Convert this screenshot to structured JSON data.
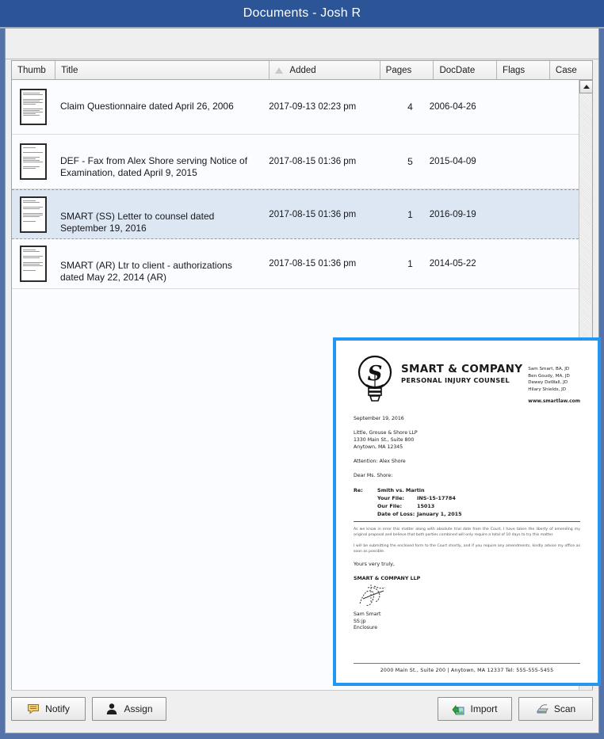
{
  "window": {
    "title": "Documents - Josh R"
  },
  "grid": {
    "columns": [
      {
        "key": "thumb",
        "label": "Thumb",
        "sorted": false
      },
      {
        "key": "title",
        "label": "Title",
        "sorted": false
      },
      {
        "key": "added",
        "label": "Added",
        "sorted": true,
        "sort_direction": "ascending"
      },
      {
        "key": "pages",
        "label": "Pages",
        "sorted": false
      },
      {
        "key": "docdate",
        "label": "DocDate",
        "sorted": false
      },
      {
        "key": "flags",
        "label": "Flags",
        "sorted": false
      },
      {
        "key": "case",
        "label": "Case",
        "sorted": false
      }
    ],
    "rows": [
      {
        "title": "Claim Questionnaire dated April 26, 2006",
        "added": "2017-09-13 02:23 pm",
        "pages": "4",
        "docdate": "2006-04-26",
        "flags": "",
        "case": "",
        "selected": false
      },
      {
        "title": "DEF - Fax from Alex Shore serving Notice of Examination, dated April 9, 2015",
        "added": "2017-08-15 01:36 pm",
        "pages": "5",
        "docdate": "2015-04-09",
        "flags": "",
        "case": "",
        "selected": false
      },
      {
        "title": "SMART (SS) Letter to counsel dated September 19, 2016",
        "added": "2017-08-15 01:36 pm",
        "pages": "1",
        "docdate": "2016-09-19",
        "flags": "",
        "case": "",
        "selected": true
      },
      {
        "title": "SMART (AR) Ltr to client - authorizations dated May 22, 2014 (AR)",
        "added": "2017-08-15 01:36 pm",
        "pages": "1",
        "docdate": "2014-05-22",
        "flags": "",
        "case": "",
        "selected": false
      }
    ],
    "scrollbar": {
      "up_arrow_icon": "triangle-up-icon"
    }
  },
  "preview": {
    "border_color": "#2196f3",
    "letterhead": {
      "logo_icon": "lightbulb-s-logo-icon",
      "firm_name": "SMART & COMPANY",
      "firm_subtitle": "PERSONAL INJURY COUNSEL",
      "lawyers": [
        "Sam Smart, BA, JD",
        "Ben Goudy, MA, JD",
        "Dewey DeWall, JD",
        "Hilary Shields, JD"
      ],
      "website": "www.smartlaw.com"
    },
    "date": "September 19, 2016",
    "recipient": [
      "Little, Grouse & Shore LLP",
      "1330 Main St., Suite 800",
      "Anytown, MA 12345"
    ],
    "attention": "Attention: Alex Shore",
    "salutation": "Dear Ms. Shore:",
    "re_block": {
      "label": "Re:",
      "matter": "Smith vs. Martin",
      "rows": [
        {
          "key": "Your File:",
          "value": "INS-15-17784"
        },
        {
          "key": "Our File:",
          "value": "15013"
        },
        {
          "key": "Date of Loss:",
          "value": "January 1, 2015"
        }
      ]
    },
    "paragraphs": [
      "As we know in error this matter along with absolute trial date from the Court, I have taken the liberty of amending my original proposal and believe that both parties combined will only require a total of 10 days to try this matter.",
      "I will be submitting the enclosed form to the Court shortly, and if you require any amendments, kindly advise my office as soon as possible."
    ],
    "closing": "Yours very truly,",
    "signature_firm": "SMART & COMPANY LLP",
    "signature_icon": "handwritten-signature-icon",
    "signer": "Sam Smart",
    "initials": "SS:jp",
    "enclosure": "Enclosure",
    "footer": "2000 Main St., Suite 200  |   Anytown, MA 12337  Tel: 555-555-5455"
  },
  "buttons": {
    "notify": {
      "label": "Notify",
      "icon": "speech-bubble-icon"
    },
    "assign": {
      "label": "Assign",
      "icon": "person-icon"
    },
    "import": {
      "label": "Import",
      "icon": "import-image-icon"
    },
    "scan": {
      "label": "Scan",
      "icon": "scanner-icon"
    }
  }
}
